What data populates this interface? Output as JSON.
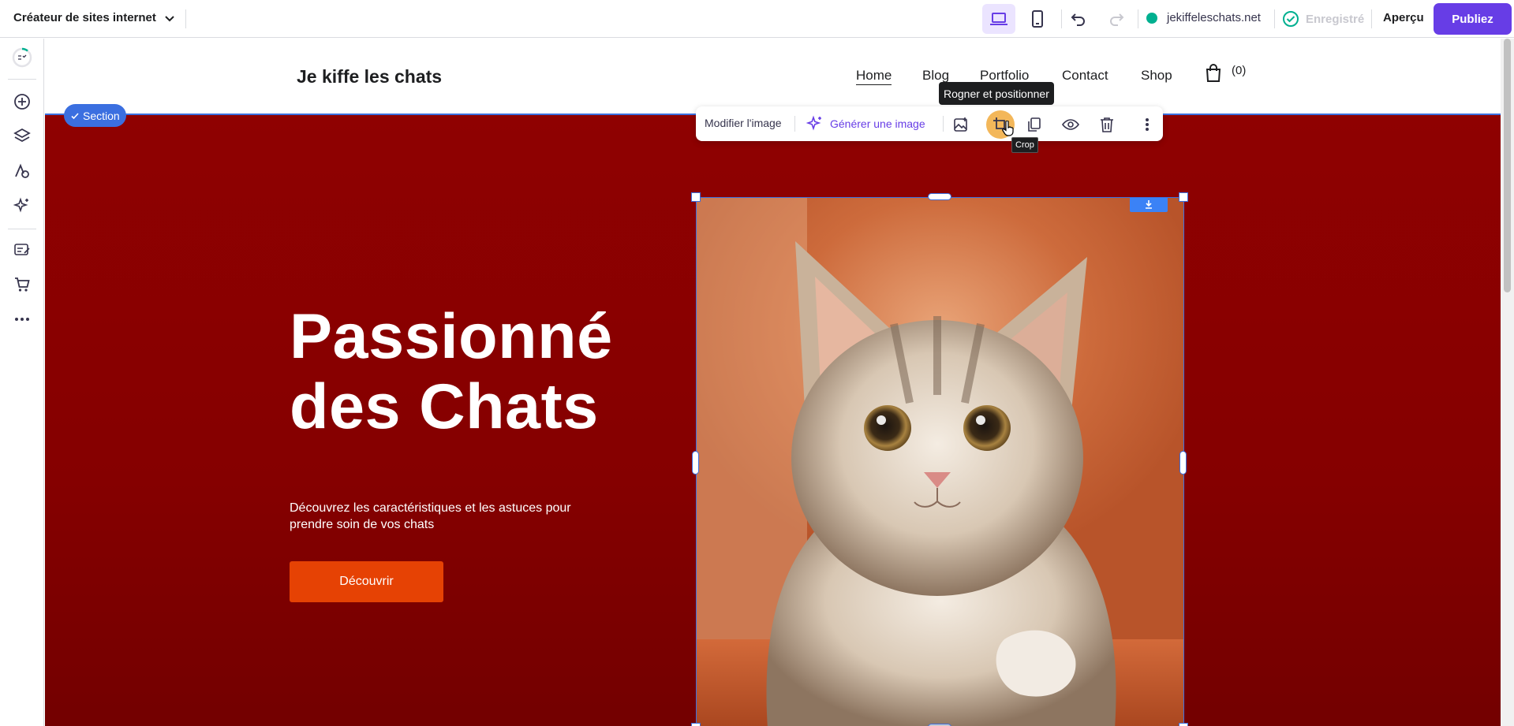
{
  "topbar": {
    "app_title": "Créateur de sites internet",
    "domain": "jekiffeleschats.net",
    "saved_status": "Enregistré",
    "preview_label": "Aperçu",
    "publish_label": "Publiez",
    "colors": {
      "publish": "#673de6",
      "domain_dot": "#00b090",
      "saved": "#00b090"
    }
  },
  "site": {
    "brand": "Je kiffe les chats",
    "nav": [
      "Home",
      "Blog",
      "Portfolio",
      "Contact",
      "Shop"
    ],
    "cart_count": "(0)"
  },
  "section_badge": "Section",
  "hero": {
    "title_line1": "Passionné",
    "title_line2": "des Chats",
    "subtitle_line1": "Découvrez les caractéristiques et les astuces pour",
    "subtitle_line2": "prendre soin de vos chats",
    "cta": "Découvrir",
    "colors": {
      "background": "#8b0000",
      "cta": "#e64204"
    }
  },
  "image_toolbar": {
    "edit_label": "Modifier l'image",
    "generate_label": "Générer une image",
    "tooltip": "Rogner et positionner",
    "small_tooltip": "Crop"
  }
}
